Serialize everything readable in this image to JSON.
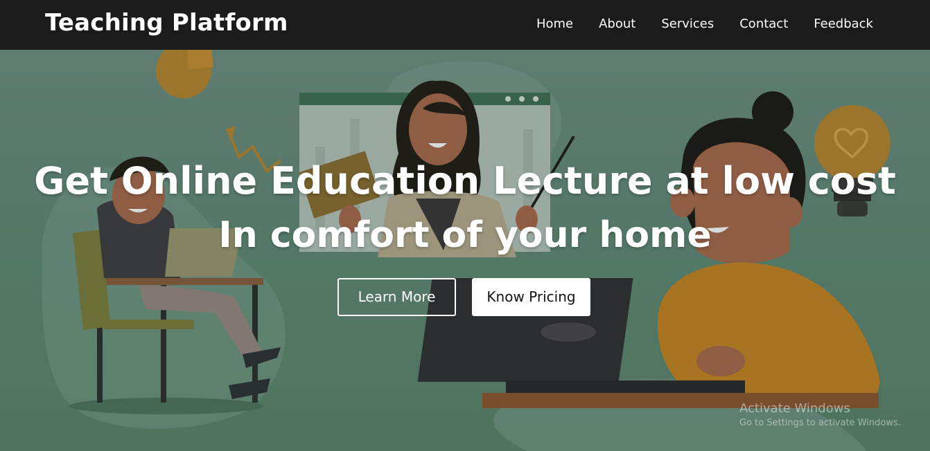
{
  "navbar": {
    "brand": "Teaching Platform",
    "links": [
      "Home",
      "About",
      "Services",
      "Contact",
      "Feedback"
    ]
  },
  "hero": {
    "headline_line1": "Get Online Education Lecture at low cost",
    "headline_line2": "In comfort of your home",
    "buttons": {
      "learn_more": "Learn More",
      "know_pricing": "Know Pricing"
    }
  },
  "watermark": {
    "title": "Activate Windows",
    "subtitle": "Go to Settings to activate Windows."
  },
  "colors": {
    "navbar_bg": "#1b1b1b",
    "hero_bg": "#5f8573",
    "button_text_dark": "#111111"
  }
}
